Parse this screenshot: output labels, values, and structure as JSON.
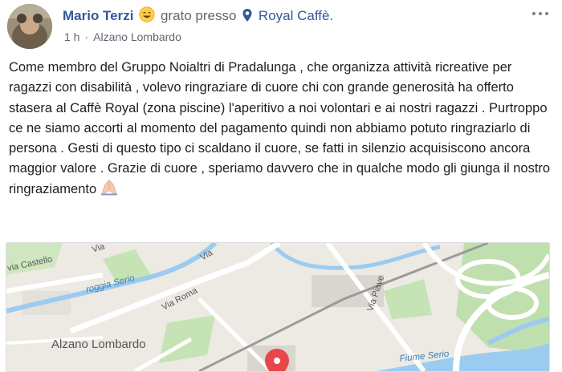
{
  "post": {
    "author": "Mario Terzi",
    "feeling_text": "grato presso",
    "place": "Royal Caffè.",
    "timestamp": "1 h",
    "location": "Alzano Lombardo",
    "text": "Come membro del Gruppo Noialtri di Pradalunga , che organizza attività ricreative per ragazzi con disabilità , volevo ringraziare di cuore chi con grande generosità ha offerto stasera al Caffè Royal (zona piscine) l'aperitivo a noi volontari e ai nostri ragazzi . Purtroppo ce ne siamo accorti al momento del pagamento quindi non abbiamo potuto ringraziarlo di persona . Gesti di questo tipo ci scaldano il cuore, se fatti in silenzio acquisiscono ancora maggior valore . Grazie di cuore , speriamo davvero che in qualche modo gli giunga il nostro ringraziamento",
    "feeling_icon": "smiling-face-icon",
    "place_icon": "map-pin-icon",
    "end_emoji": "praying-hands-icon"
  },
  "map": {
    "labels": {
      "castello": "via Castello",
      "roggia": "roggia Serio",
      "via_roma": "Via Roma",
      "via_top1": "Via",
      "via_top2": "Via",
      "piave": "Via Piave",
      "town": "Alzano Lombardo",
      "fiume": "Fiume Serio"
    },
    "colors": {
      "background": "#eceae3",
      "water": "#9ccbf0",
      "park": "#c5e3b5",
      "road": "#ffffff",
      "building": "#d8d6cf",
      "marker": "#e8474a"
    }
  },
  "colors": {
    "link": "#365899",
    "text": "#1c1e21",
    "meta": "#606770"
  }
}
